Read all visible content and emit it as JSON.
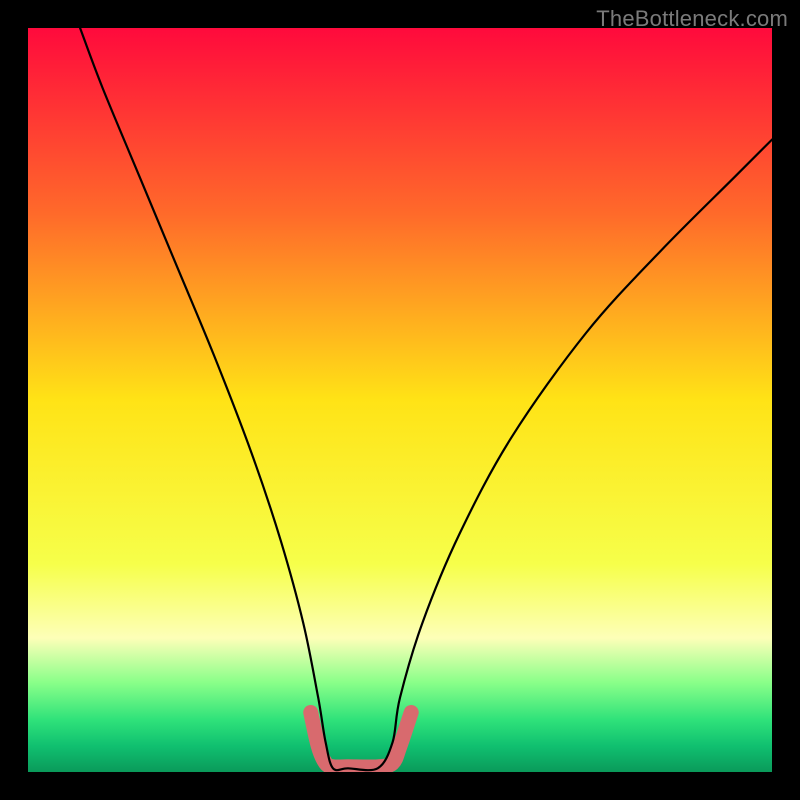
{
  "watermark": {
    "text": "TheBottleneck.com"
  },
  "chart_data": {
    "type": "line",
    "title": "",
    "xlabel": "",
    "ylabel": "",
    "xlim": [
      0,
      100
    ],
    "ylim": [
      0,
      100
    ],
    "series": [
      {
        "name": "bottleneck-curve",
        "x": [
          7,
          10,
          15,
          20,
          25,
          30,
          34,
          37,
          39,
          40,
          41,
          43,
          47,
          49,
          50,
          53,
          58,
          65,
          75,
          85,
          95,
          100
        ],
        "values": [
          100,
          92,
          80,
          68,
          56,
          43,
          31,
          20,
          10,
          4,
          0.5,
          0.5,
          0.5,
          4,
          10,
          20,
          32,
          45,
          59,
          70,
          80,
          85
        ]
      },
      {
        "name": "optimal-band",
        "x": [
          38,
          39,
          40,
          41,
          43,
          47,
          49,
          50,
          51.5
        ],
        "values": [
          8,
          3.5,
          1.2,
          0.7,
          0.7,
          0.7,
          1.2,
          3.5,
          8
        ]
      }
    ],
    "gradient_stops": [
      {
        "offset": 0,
        "color": "#ff0a3c"
      },
      {
        "offset": 0.25,
        "color": "#ff6a2a"
      },
      {
        "offset": 0.5,
        "color": "#ffe316"
      },
      {
        "offset": 0.72,
        "color": "#f6ff4a"
      },
      {
        "offset": 0.82,
        "color": "#fdffb8"
      },
      {
        "offset": 0.88,
        "color": "#89ff89"
      },
      {
        "offset": 0.93,
        "color": "#2fe27a"
      },
      {
        "offset": 0.965,
        "color": "#10c070"
      },
      {
        "offset": 1.0,
        "color": "#0a9a5a"
      }
    ],
    "band_color": "#d86a6e",
    "curve_color": "#000000"
  }
}
